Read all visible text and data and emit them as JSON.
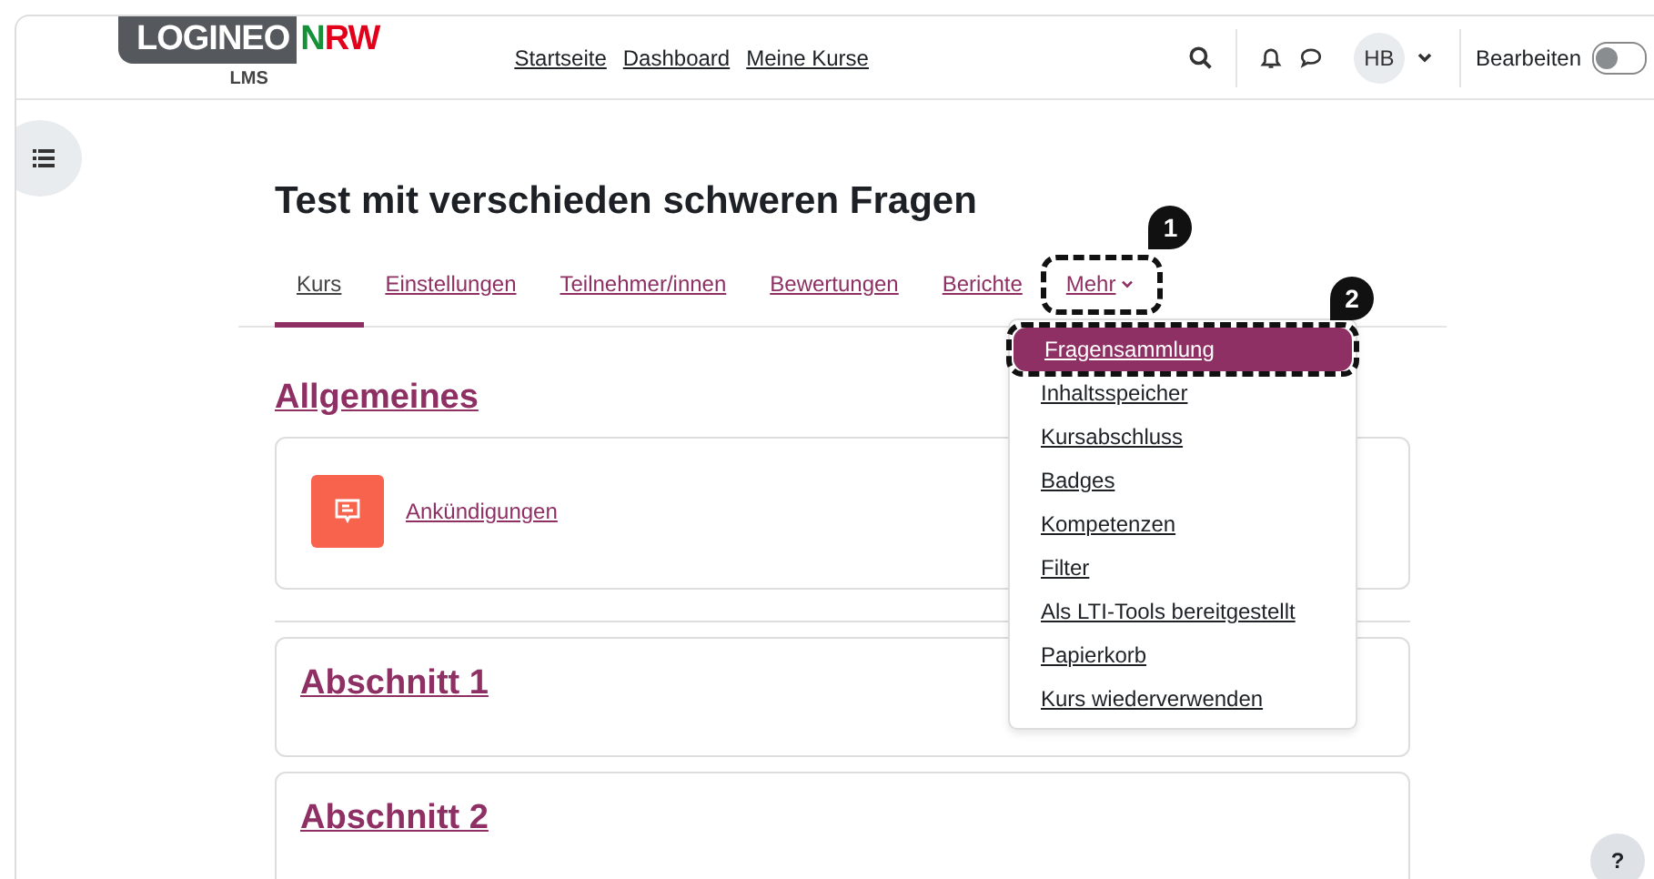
{
  "navbar": {
    "logo": {
      "brand": "LOGINEO",
      "accent": "NRW",
      "sub": "LMS"
    },
    "links": [
      "Startseite",
      "Dashboard",
      "Meine Kurse"
    ],
    "user": {
      "initials": "HB"
    },
    "edit_mode": {
      "label": "Bearbeiten",
      "on": false
    }
  },
  "course": {
    "title": "Test mit verschieden schweren Fragen"
  },
  "tabs": [
    {
      "label": "Kurs",
      "selected": true
    },
    {
      "label": "Einstellungen",
      "selected": false
    },
    {
      "label": "Teilnehmer/innen",
      "selected": false
    },
    {
      "label": "Bewertungen",
      "selected": false
    },
    {
      "label": "Berichte",
      "selected": false
    },
    {
      "label": "Mehr",
      "selected": false,
      "kind": "dropdown",
      "callout": "1"
    }
  ],
  "more_menu": {
    "callout": "2",
    "items": [
      {
        "label": "Fragensammlung",
        "selected": true
      },
      {
        "label": "Inhaltsspeicher",
        "selected": false
      },
      {
        "label": "Kursabschluss",
        "selected": false
      },
      {
        "label": "Badges",
        "selected": false
      },
      {
        "label": "Kompetenzen",
        "selected": false
      },
      {
        "label": "Filter",
        "selected": false
      },
      {
        "label": "Als LTI-Tools bereitgestellt",
        "selected": false
      },
      {
        "label": "Papierkorb",
        "selected": false
      },
      {
        "label": "Kurs wiederverwenden",
        "selected": false
      }
    ]
  },
  "sections": [
    {
      "title": "Allgemeines",
      "activities": [
        {
          "label": "Ankündigungen"
        }
      ]
    },
    {
      "title": "Abschnitt 1"
    },
    {
      "title": "Abschnitt 2"
    }
  ],
  "help": {
    "label": "?"
  }
}
